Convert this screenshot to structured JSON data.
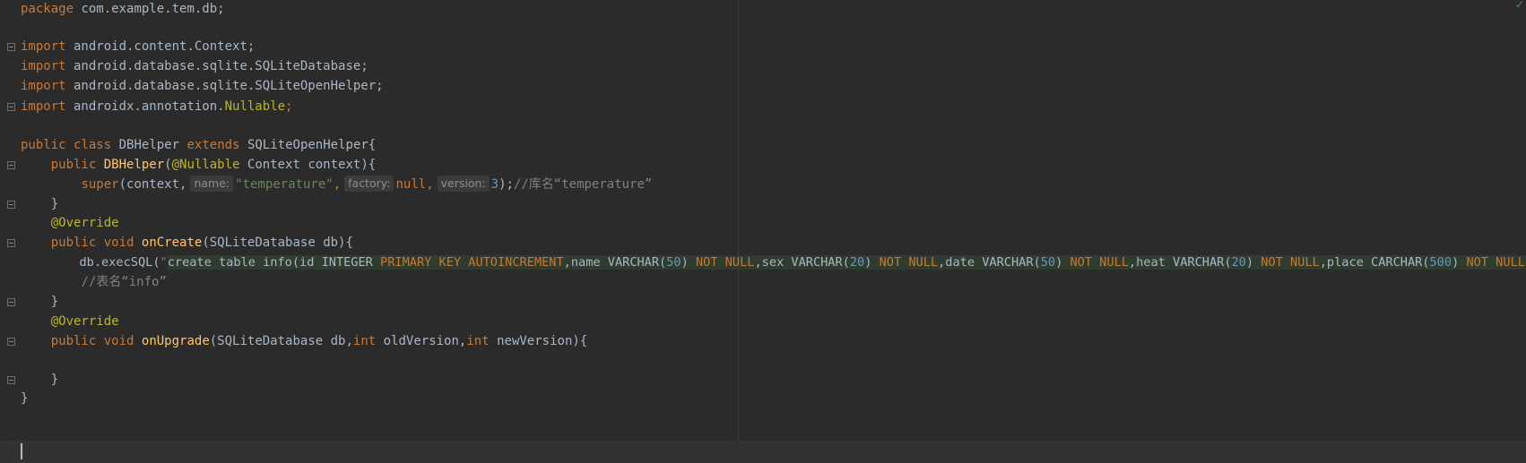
{
  "status": {
    "check_mark": "✓"
  },
  "lines": {
    "l1": {
      "kw": "package",
      "rest": " com.example.tem.db;"
    },
    "l3": {
      "kw": "import",
      "rest": " android.content.Context;"
    },
    "l4": {
      "kw": "import",
      "rest": " android.database.sqlite.SQLiteDatabase;"
    },
    "l5": {
      "kw": "import",
      "rest": " android.database.sqlite.SQLiteOpenHelper;"
    },
    "l6": {
      "kw": "import",
      "rest": " androidx.annotation.",
      "ann": "Nullable",
      "end": ";"
    },
    "l8": {
      "kw1": "public",
      "kw2": "class",
      "name": "DBHelper",
      "kw3": "extends",
      "parent": "SQLiteOpenHelper",
      "brace": "{"
    },
    "l9": {
      "kw": "public",
      "fn": "DBHelper",
      "open": "(",
      "ann": "@Nullable",
      "rest": " Context context){"
    },
    "l10": {
      "kw": "super",
      "open": "(context,",
      "hint_name": "name:",
      "str": "\"temperature\"",
      "sep1": ",",
      "hint_factory": "factory:",
      "null_kw": "null",
      "sep2": ",",
      "hint_version": "version:",
      "num": "3",
      "close": ");",
      "cmt": "//库名“temperature”"
    },
    "l11": {
      "text": "}"
    },
    "l12": {
      "ann": "@Override"
    },
    "l13": {
      "kw1": "public",
      "kw2": "void",
      "fn": "onCreate",
      "rest": "(SQLiteDatabase db){"
    },
    "l14": {
      "pre": "db.execSQL(",
      "q1": "\"",
      "s1": "create table info(id INTEGER ",
      "k1": "PRIMARY KEY AUTOINCREMENT",
      "s2": ",name VARCHAR(",
      "n1": "50",
      "s3": ") ",
      "k2": "NOT NULL",
      "s4": ",sex VARCHAR(",
      "n2": "20",
      "s5": ") ",
      "k3": "NOT NULL",
      "s6": ",date VARCHAR(",
      "n3": "50",
      "s7": ") ",
      "k4": "NOT NULL",
      "s8": ",heat VARCHAR(",
      "n4": "20",
      "s9": ") ",
      "k5": "NOT NULL",
      "s10": ",place CARCHAR(",
      "n5": "500",
      "s11": ") ",
      "k6": "NOT NULL",
      "s12": ")",
      "q2": "\"",
      "end": ");"
    },
    "l15": {
      "cmt": "//表名“info”"
    },
    "l16": {
      "text": "}"
    },
    "l17": {
      "ann": "@Override"
    },
    "l18": {
      "kw1": "public",
      "kw2": "void",
      "fn": "onUpgrade",
      "r1": "(SQLiteDatabase db,",
      "kw3": "int",
      "r2": " oldVersion,",
      "kw4": "int",
      "r3": " newVersion){"
    },
    "l20": {
      "text": "}"
    },
    "l21": {
      "text": "}"
    }
  }
}
